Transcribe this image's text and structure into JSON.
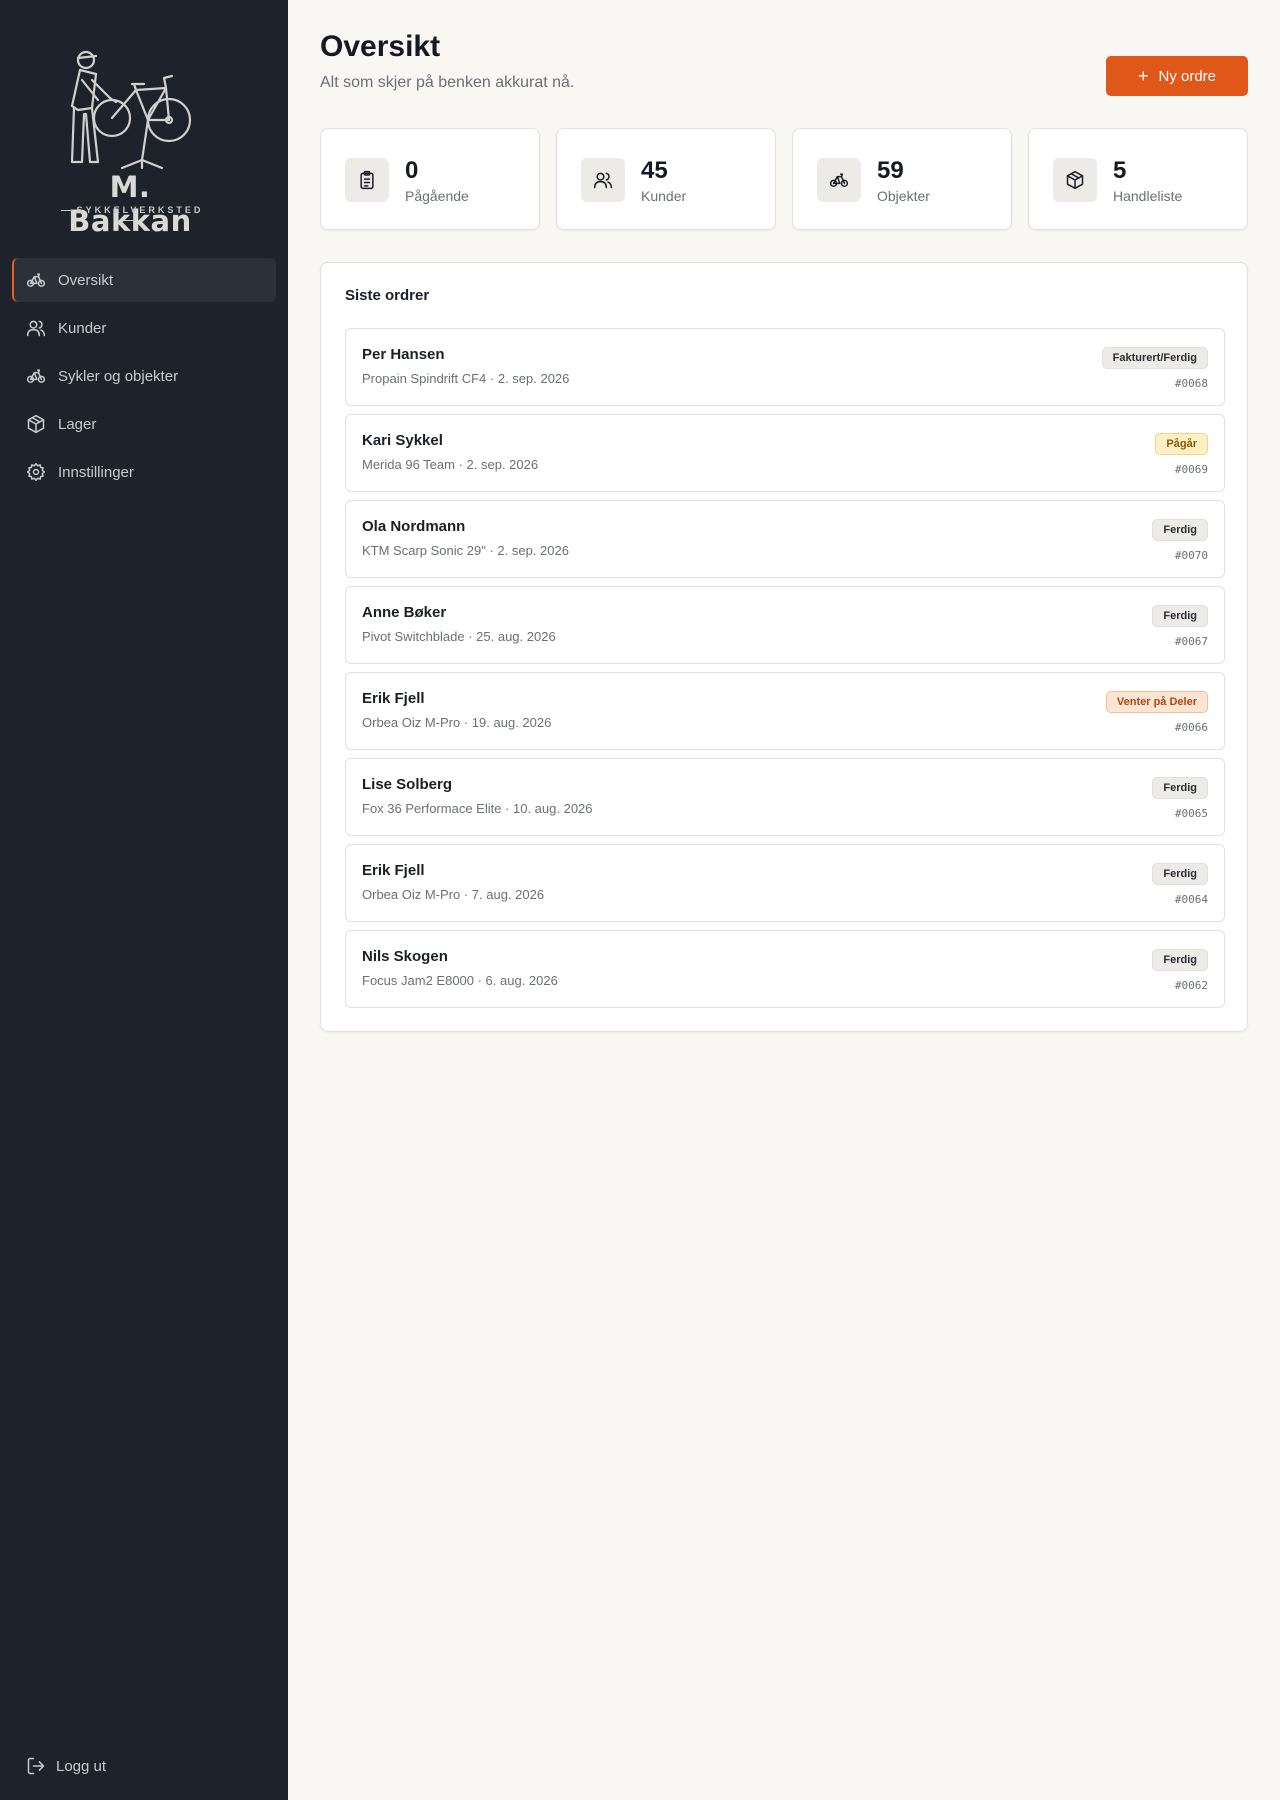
{
  "brand": {
    "name": "M. Bakkan",
    "subtitle": "SYKKELVERKSTED"
  },
  "nav": [
    {
      "label": "Oversikt",
      "icon": "bike-icon",
      "active": true
    },
    {
      "label": "Kunder",
      "icon": "users-icon"
    },
    {
      "label": "Sykler og objekter",
      "icon": "bike-icon"
    },
    {
      "label": "Lager",
      "icon": "box-icon"
    },
    {
      "label": "Innstillinger",
      "icon": "gear-icon"
    }
  ],
  "logout_label": "Logg ut",
  "header": {
    "title": "Oversikt",
    "subtitle": "Alt som skjer på benken akkurat nå.",
    "new_order_label": "Ny ordre"
  },
  "stats": [
    {
      "value": "0",
      "label": "Pågående",
      "icon": "clipboard-icon"
    },
    {
      "value": "45",
      "label": "Kunder",
      "icon": "users-icon"
    },
    {
      "value": "59",
      "label": "Objekter",
      "icon": "bike-icon"
    },
    {
      "value": "5",
      "label": "Handleliste",
      "icon": "box-icon"
    }
  ],
  "orders": {
    "title": "Siste ordrer",
    "items": [
      {
        "name": "Per Hansen",
        "meta": "Propain Spindrift CF4 · 2. sep. 2026",
        "status": "Fakturert/Ferdig",
        "status_type": "neutral",
        "number": "#0068"
      },
      {
        "name": "Kari Sykkel",
        "meta": "Merida 96 Team · 2. sep. 2026",
        "status": "Pågår",
        "status_type": "pagar",
        "number": "#0069"
      },
      {
        "name": "Ola Nordmann",
        "meta": "KTM Scarp Sonic 29\" · 2. sep. 2026",
        "status": "Ferdig",
        "status_type": "neutral",
        "number": "#0070"
      },
      {
        "name": "Anne Bøker",
        "meta": "Pivot Switchblade · 25. aug. 2026",
        "status": "Ferdig",
        "status_type": "neutral",
        "number": "#0067"
      },
      {
        "name": "Erik Fjell",
        "meta": "Orbea Oiz M-Pro · 19. aug. 2026",
        "status": "Venter på Deler",
        "status_type": "venter",
        "number": "#0066"
      },
      {
        "name": "Lise Solberg",
        "meta": "Fox 36 Performace Elite · 10. aug. 2026",
        "status": "Ferdig",
        "status_type": "neutral",
        "number": "#0065"
      },
      {
        "name": "Erik Fjell",
        "meta": "Orbea Oiz M-Pro · 7. aug. 2026",
        "status": "Ferdig",
        "status_type": "neutral",
        "number": "#0064"
      },
      {
        "name": "Nils Skogen",
        "meta": "Focus Jam2 E8000 · 6. aug. 2026",
        "status": "Ferdig",
        "status_type": "neutral",
        "number": "#0062"
      }
    ]
  },
  "colors": {
    "sidebar": "#1e232b",
    "accent": "#e0571a",
    "background": "#f8f7f4"
  }
}
